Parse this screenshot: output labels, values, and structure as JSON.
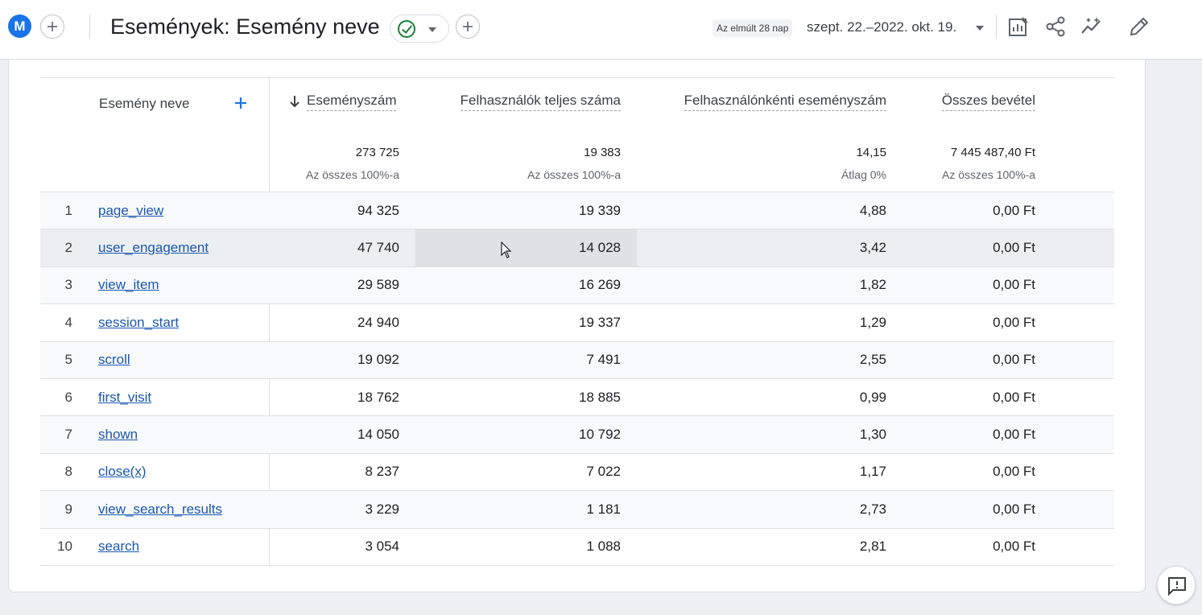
{
  "header": {
    "avatar_letter": "M",
    "title": "Események: Esemény neve",
    "date_chip": "Az elmúlt 28 nap",
    "date_range": "szept. 22.–2022. okt. 19."
  },
  "table": {
    "columns": {
      "name": "Esemény neve",
      "event_count": "Eseményszám",
      "total_users": "Felhasználók teljes száma",
      "events_per_user": "Felhasználónkénti eseményszám",
      "total_revenue": "Összes bevétel"
    },
    "totals": {
      "event_count": "273 725",
      "event_count_sub": "Az összes 100%-a",
      "total_users": "19 383",
      "total_users_sub": "Az összes 100%-a",
      "events_per_user": "14,15",
      "events_per_user_sub": "Átlag 0%",
      "total_revenue": "7 445 487,40 Ft",
      "total_revenue_sub": "Az összes 100%-a"
    },
    "rows": [
      {
        "idx": "1",
        "name": "page_view",
        "count": "94 325",
        "users": "19 339",
        "per_user": "4,88",
        "revenue": "0,00 Ft"
      },
      {
        "idx": "2",
        "name": "user_engagement",
        "count": "47 740",
        "users": "14 028",
        "per_user": "3,42",
        "revenue": "0,00 Ft"
      },
      {
        "idx": "3",
        "name": "view_item",
        "count": "29 589",
        "users": "16 269",
        "per_user": "1,82",
        "revenue": "0,00 Ft"
      },
      {
        "idx": "4",
        "name": "session_start",
        "count": "24 940",
        "users": "19 337",
        "per_user": "1,29",
        "revenue": "0,00 Ft"
      },
      {
        "idx": "5",
        "name": "scroll",
        "count": "19 092",
        "users": "7 491",
        "per_user": "2,55",
        "revenue": "0,00 Ft"
      },
      {
        "idx": "6",
        "name": "first_visit",
        "count": "18 762",
        "users": "18 885",
        "per_user": "0,99",
        "revenue": "0,00 Ft"
      },
      {
        "idx": "7",
        "name": "shown",
        "count": "14 050",
        "users": "10 792",
        "per_user": "1,30",
        "revenue": "0,00 Ft"
      },
      {
        "idx": "8",
        "name": "close(x)",
        "count": "8 237",
        "users": "7 022",
        "per_user": "1,17",
        "revenue": "0,00 Ft"
      },
      {
        "idx": "9",
        "name": "view_search_results",
        "count": "3 229",
        "users": "1 181",
        "per_user": "2,73",
        "revenue": "0,00 Ft"
      },
      {
        "idx": "10",
        "name": "search",
        "count": "3 054",
        "users": "1 088",
        "per_user": "2,81",
        "revenue": "0,00 Ft"
      }
    ]
  }
}
